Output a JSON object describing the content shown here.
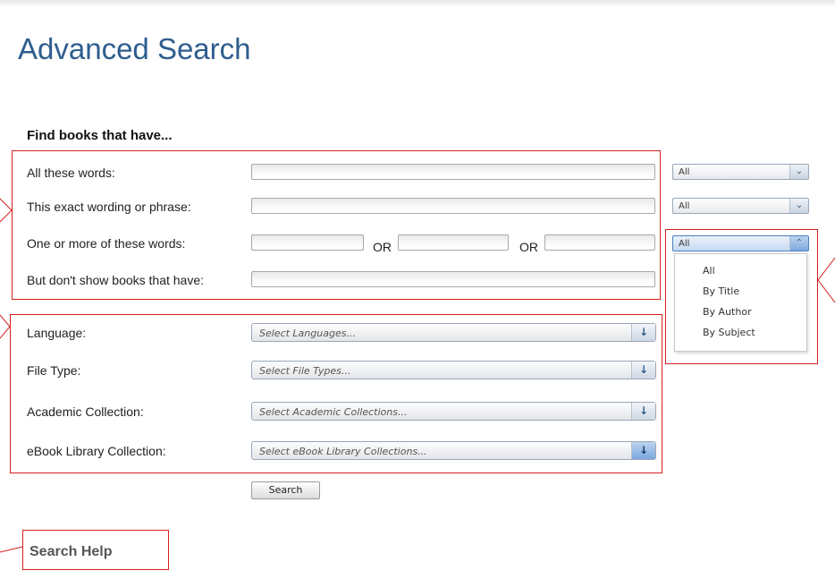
{
  "page": {
    "title": "Advanced Search"
  },
  "find": {
    "heading": "Find books that have...",
    "rows": [
      {
        "label": "All these words:",
        "scope": "All"
      },
      {
        "label": "This exact wording or phrase:",
        "scope": "All"
      },
      {
        "label": "One or more of these words:",
        "scope": "All",
        "or_label": "OR"
      },
      {
        "label": "But don't show books that have:"
      }
    ]
  },
  "scope_dropdown": {
    "options": [
      "All",
      "By Title",
      "By Author",
      "By Subject"
    ]
  },
  "filters": [
    {
      "label": "Language:",
      "placeholder": "Select Languages..."
    },
    {
      "label": "File Type:",
      "placeholder": "Select File Types..."
    },
    {
      "label": "Academic Collection:",
      "placeholder": "Select Academic Collections..."
    },
    {
      "label": "eBook Library Collection:",
      "placeholder": "Select eBook Library Collections..."
    }
  ],
  "actions": {
    "search_label": "Search"
  },
  "help": {
    "label": "Search Help"
  },
  "colors": {
    "title": "#2e5d8e",
    "annotation": "#d42020"
  },
  "icons": {
    "scope_closed": "double-chevron-down-icon",
    "scope_open": "double-chevron-up-icon",
    "combo": "arrow-down-icon"
  }
}
